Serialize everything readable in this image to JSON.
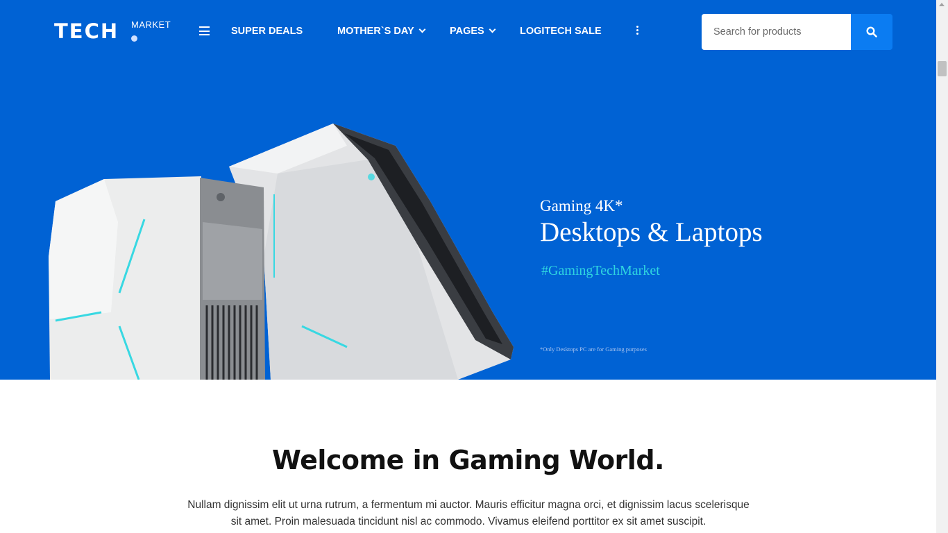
{
  "header": {
    "logo_main": "TECH",
    "logo_sub": "MARKET",
    "nav": {
      "super_deals": "SUPER DEALS",
      "mothers_day": "MOTHER`S DAY",
      "pages": "PAGES",
      "logitech_sale": "LOGITECH SALE"
    },
    "search": {
      "placeholder": "Search for products",
      "value": ""
    }
  },
  "hero": {
    "pre_title": "Gaming 4K*",
    "title": "Desktops & Laptops",
    "hashtag": "#GamingTechMarket",
    "footnote": "*Only Desktops PC are for Gaming purposes"
  },
  "welcome": {
    "title": "Welcome in Gaming World.",
    "text": "Nullam dignissim elit ut urna rutrum, a fermentum mi auctor. Mauris efficitur magna orci, et dignissim lacus scelerisque sit amet. Proin malesuada tincidunt nisl ac commodo. Vivamus eleifend porttitor ex sit amet suscipit."
  },
  "colors": {
    "brand_blue": "#0062d4",
    "search_button": "#0b7cf2",
    "accent_cyan": "#2fd6e0"
  },
  "icons": [
    "menu-icon",
    "chevron-down-icon",
    "more-vertical-icon",
    "search-icon"
  ]
}
